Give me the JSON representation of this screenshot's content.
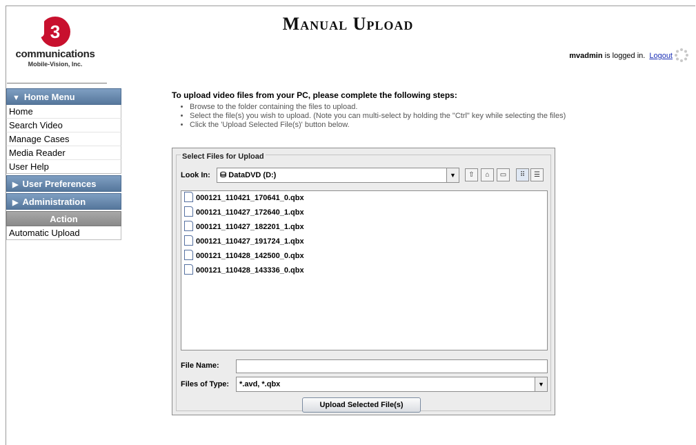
{
  "logo": {
    "mark": "3",
    "company": "communications",
    "sub": "Mobile-Vision, Inc."
  },
  "header": {
    "title": "Manual Upload",
    "user": "mvadmin",
    "logged_in_text": " is logged in.",
    "logout_label": "Logout"
  },
  "sidebar": {
    "home_menu": {
      "label": "Home Menu",
      "icon": "triangle-down-icon",
      "items": [
        "Home",
        "Search Video",
        "Manage Cases",
        "Media Reader",
        "User Help"
      ]
    },
    "user_prefs": {
      "label": "User Preferences",
      "icon": "triangle-right-icon"
    },
    "administration": {
      "label": "Administration",
      "icon": "triangle-right-icon"
    },
    "action": {
      "label": "Action",
      "items": [
        "Automatic Upload"
      ]
    }
  },
  "instructions": {
    "title": "To upload video files from your PC, please complete the following steps:",
    "steps": [
      "Browse to the folder containing the files to upload.",
      "Select the file(s) you wish to upload. (Note you can multi-select by holding the \"Ctrl\" key while selecting the files)",
      "Click the 'Upload Selected File(s)' button below."
    ]
  },
  "chooser": {
    "legend": "Select Files for Upload",
    "look_in_label": "Look In:",
    "look_in_value": "DataDVD (D:)",
    "files": [
      "000121_110421_170641_0.qbx",
      "000121_110427_172640_1.qbx",
      "000121_110427_182201_1.qbx",
      "000121_110427_191724_1.qbx",
      "000121_110428_142500_0.qbx",
      "000121_110428_143336_0.qbx"
    ],
    "file_name_label": "File Name:",
    "file_name_value": "",
    "files_of_type_label": "Files of Type:",
    "files_of_type_value": "*.avd, *.qbx",
    "upload_button": "Upload Selected File(s)"
  },
  "colors": {
    "nav_header": "#56779c",
    "action_header": "#8a8a8a",
    "logo_red": "#c8102e",
    "link": "#1a2fb5"
  }
}
